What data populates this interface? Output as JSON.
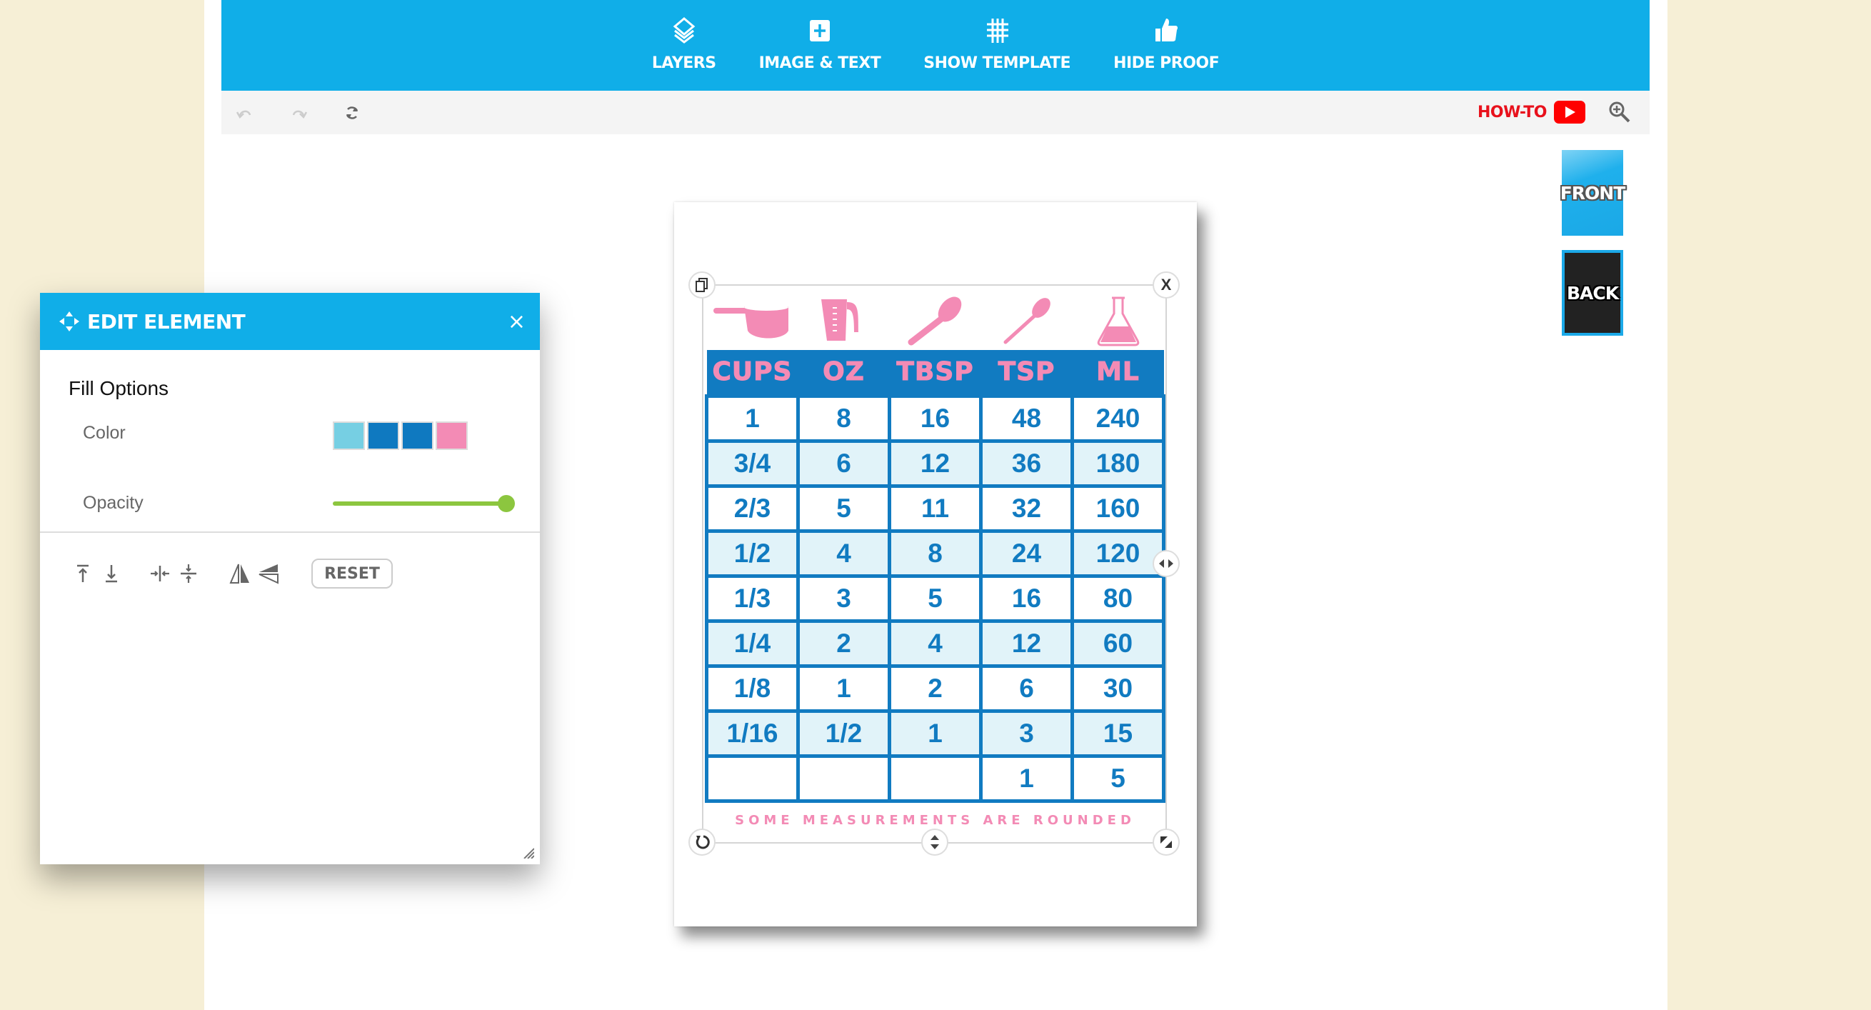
{
  "toolbar": {
    "items": [
      {
        "label": "LAYERS",
        "icon": "layers-icon"
      },
      {
        "label": "IMAGE & TEXT",
        "icon": "plus-square-icon"
      },
      {
        "label": "SHOW TEMPLATE",
        "icon": "grid-icon"
      },
      {
        "label": "HIDE PROOF",
        "icon": "thumbs-up-icon"
      }
    ],
    "undo_icon": "undo-icon",
    "redo_icon": "redo-icon",
    "refresh_icon": "refresh-icon",
    "howto_label": "HOW-TO",
    "zoom_icon": "zoom-in-icon"
  },
  "sides": {
    "front_label": "FRONT",
    "back_label": "BACK"
  },
  "panel": {
    "title": "EDIT ELEMENT",
    "close": "×",
    "section_title": "Fill Options",
    "color_label": "Color",
    "colors": [
      "#76cfe3",
      "#0f79c0",
      "#0f79c0",
      "#f38bb5"
    ],
    "opacity_label": "Opacity",
    "opacity_value": 1.0,
    "reset_label": "RESET",
    "accent": "#10aee8",
    "slider_color": "#8cc63f"
  },
  "design": {
    "headers": [
      "CUPS",
      "OZ",
      "TBSP",
      "TSP",
      "ML"
    ],
    "icons": [
      "measuring-cup-icon",
      "measuring-jug-icon",
      "tablespoon-icon",
      "teaspoon-icon",
      "flask-icon"
    ],
    "rows": [
      [
        "1",
        "8",
        "16",
        "48",
        "240"
      ],
      [
        "3/4",
        "6",
        "12",
        "36",
        "180"
      ],
      [
        "2/3",
        "5",
        "11",
        "32",
        "160"
      ],
      [
        "1/2",
        "4",
        "8",
        "24",
        "120"
      ],
      [
        "1/3",
        "3",
        "5",
        "16",
        "80"
      ],
      [
        "1/4",
        "2",
        "4",
        "12",
        "60"
      ],
      [
        "1/8",
        "1",
        "2",
        "6",
        "30"
      ],
      [
        "1/16",
        "1/2",
        "1",
        "3",
        "15"
      ],
      [
        "",
        "",
        "",
        "1",
        "5"
      ]
    ],
    "note": "SOME MEASUREMENTS ARE ROUNDED",
    "primary_color": "#117bc1",
    "pink_color": "#f38bb5",
    "handles": {
      "copy": "copy-icon",
      "delete": "X",
      "rotate": "rotate-icon",
      "resize_h": "resize-horizontal-icon",
      "resize_v": "resize-vertical-icon",
      "scale": "scale-icon"
    }
  }
}
